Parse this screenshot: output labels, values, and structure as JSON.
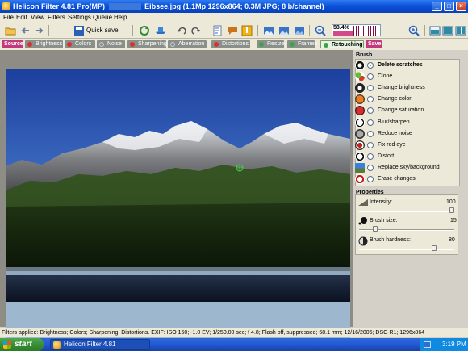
{
  "window": {
    "title_app": "Helicon Filter 4.81 Pro(MP)",
    "title_file": "Eibsee.jpg (1.1Mp 1296x864; 0.3M JPG; 8 b/channel)",
    "minimize": "_",
    "maximize": "□",
    "close": "×"
  },
  "menu": [
    "File",
    "Edit",
    "View",
    "Filters",
    "Settings",
    "Queue",
    "Help"
  ],
  "toolbar": {
    "quick_save": "Quick save",
    "zoom_value": "58.4%",
    "zoom_fraction": 0.4,
    "icons": [
      "open-icon",
      "undo-arrow-icon",
      "redo-arrow-icon",
      "quick-save-icon",
      "refresh-icon",
      "hat-icon",
      "rotate-left-icon",
      "rotate-right-icon",
      "edit-icon",
      "comment-icon",
      "info-icon",
      "image-view-1-icon",
      "image-view-2-icon",
      "image-view-3-icon",
      "zoom-out-icon",
      "zoom-in-icon",
      "layout-1-icon",
      "layout-2-icon",
      "layout-3-icon"
    ]
  },
  "tabs": {
    "source": "Source",
    "items": [
      "Brightness",
      "Colors",
      "Noise",
      "Sharpening",
      "Aberration",
      "Distortions",
      "Resize",
      "Frames",
      "Retouching"
    ],
    "save": "Save",
    "active": "Retouching"
  },
  "brush_panel": {
    "heading": "Brush",
    "items": [
      {
        "label": "Delete scratches",
        "icon": "delete-scratches-icon",
        "selected": true
      },
      {
        "label": "Clone",
        "icon": "clone-icon",
        "selected": false
      },
      {
        "label": "Change brightness",
        "icon": "brightness-icon",
        "selected": false
      },
      {
        "label": "Change color",
        "icon": "color-icon",
        "selected": false
      },
      {
        "label": "Change saturation",
        "icon": "saturation-icon",
        "selected": false
      },
      {
        "label": "Blur/sharpen",
        "icon": "blur-sharpen-icon",
        "selected": false
      },
      {
        "label": "Reduce noise",
        "icon": "reduce-noise-icon",
        "selected": false
      },
      {
        "label": "Fix red eye",
        "icon": "red-eye-icon",
        "selected": false
      },
      {
        "label": "Distort",
        "icon": "distort-icon",
        "selected": false
      },
      {
        "label": "Replace sky/background",
        "icon": "replace-sky-icon",
        "selected": false
      },
      {
        "label": "Erase changes",
        "icon": "erase-icon",
        "selected": false
      }
    ]
  },
  "properties": {
    "heading": "Properties",
    "intensity": {
      "label": "Intensity:",
      "value": "100",
      "fraction": 1.0
    },
    "brush_size": {
      "label": "Brush size:",
      "value": "15",
      "fraction": 0.15
    },
    "brush_hardness": {
      "label": "Brush hardness:",
      "value": "80",
      "fraction": 0.8
    }
  },
  "status": "Filters applied: Brightness; Colors; Sharpening; Distortions. EXIF: ISO 160; -1.0 EV; 1/250.00 sec; f 4.8; Flash off, suppressed; 68.1 mm; 12/16/2006; DSC-R1; 1296x864",
  "taskbar": {
    "start": "start",
    "task": "Helicon Filter 4.81",
    "clock": "3:19 PM"
  },
  "colors": {
    "accent": "#c33a7c",
    "title_blue": "#0a4fd8",
    "active_tab": "#e8f3e4"
  }
}
